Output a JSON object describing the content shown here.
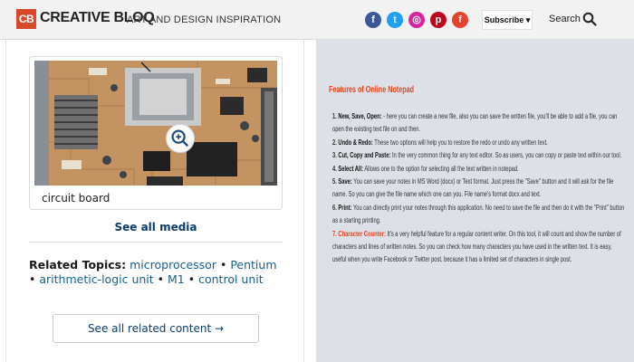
{
  "header": {
    "logo_mark": "CB",
    "logo_text": "CREATIVE BLOQ",
    "tagline": "ART AND DESIGN INSPIRATION",
    "social": [
      {
        "name": "facebook",
        "glyph": "f",
        "color": "#3b5998"
      },
      {
        "name": "twitter",
        "glyph": "t",
        "color": "#1da1f2"
      },
      {
        "name": "instagram",
        "glyph": "◎",
        "color": "#d6249f"
      },
      {
        "name": "pinterest",
        "glyph": "p",
        "color": "#bd081c"
      },
      {
        "name": "flipboard",
        "glyph": "f",
        "color": "#e8412c"
      }
    ],
    "subscribe_label": "Subscribe ▾",
    "search_label": "Search",
    "search_icon": "search-icon",
    "brand_color": "#d9482b"
  },
  "media": {
    "caption": "circuit board",
    "zoom_icon": "zoom-in-icon",
    "see_all_label": "See all media"
  },
  "related": {
    "label": "Related Topics:",
    "links": [
      "microprocessor",
      "Pentium",
      "arithmetic-logic unit",
      "M1",
      "control unit"
    ],
    "separator": " • ",
    "button_label": "See all related content →"
  },
  "right": {
    "title": "Features of Online Notepad",
    "accent_color": "#e8431f",
    "features": [
      {
        "num": "1.",
        "head": "New, Save, Open:",
        "text": "- here you can create a new file, also you can save the written file, you'll be able to add a file, you can open the existing text file on and then.",
        "highlight": false
      },
      {
        "num": "2.",
        "head": "Undo & Redo:",
        "text": "These two options will help you to restore the redo or undo any written text.",
        "highlight": false
      },
      {
        "num": "3.",
        "head": "Cut, Copy and Paste:",
        "text": "In the very common thing for any text editor. So as users, you can copy or paste text within our tool.",
        "highlight": false
      },
      {
        "num": "4.",
        "head": "Select All:",
        "text": "Allows one to the option for selecting all the text written in notepad.",
        "highlight": false
      },
      {
        "num": "5.",
        "head": "Save:",
        "text": "You can save your notes in MS Word (docx) or Text format. Just press the \"Save\" button and it will ask for the file name. So you can give the file name which one can you. File name's format docx and text.",
        "highlight": false
      },
      {
        "num": "6.",
        "head": "Print:",
        "text": "You can directly print your notes through this application. No need to save the file and then do it with the \"Print\" button as a starting printing.",
        "highlight": false
      },
      {
        "num": "7.",
        "head": "Character Counter:",
        "text": "It's a very helpful feature for a regular content writer. On this tool, it will count and show the number of characters and lines of written notes. So you can check how many characters you have used in the written text. It is easy, useful when you write Facebook or Twitter post, because it has a limited set of characters in single post.",
        "highlight": true
      }
    ]
  }
}
